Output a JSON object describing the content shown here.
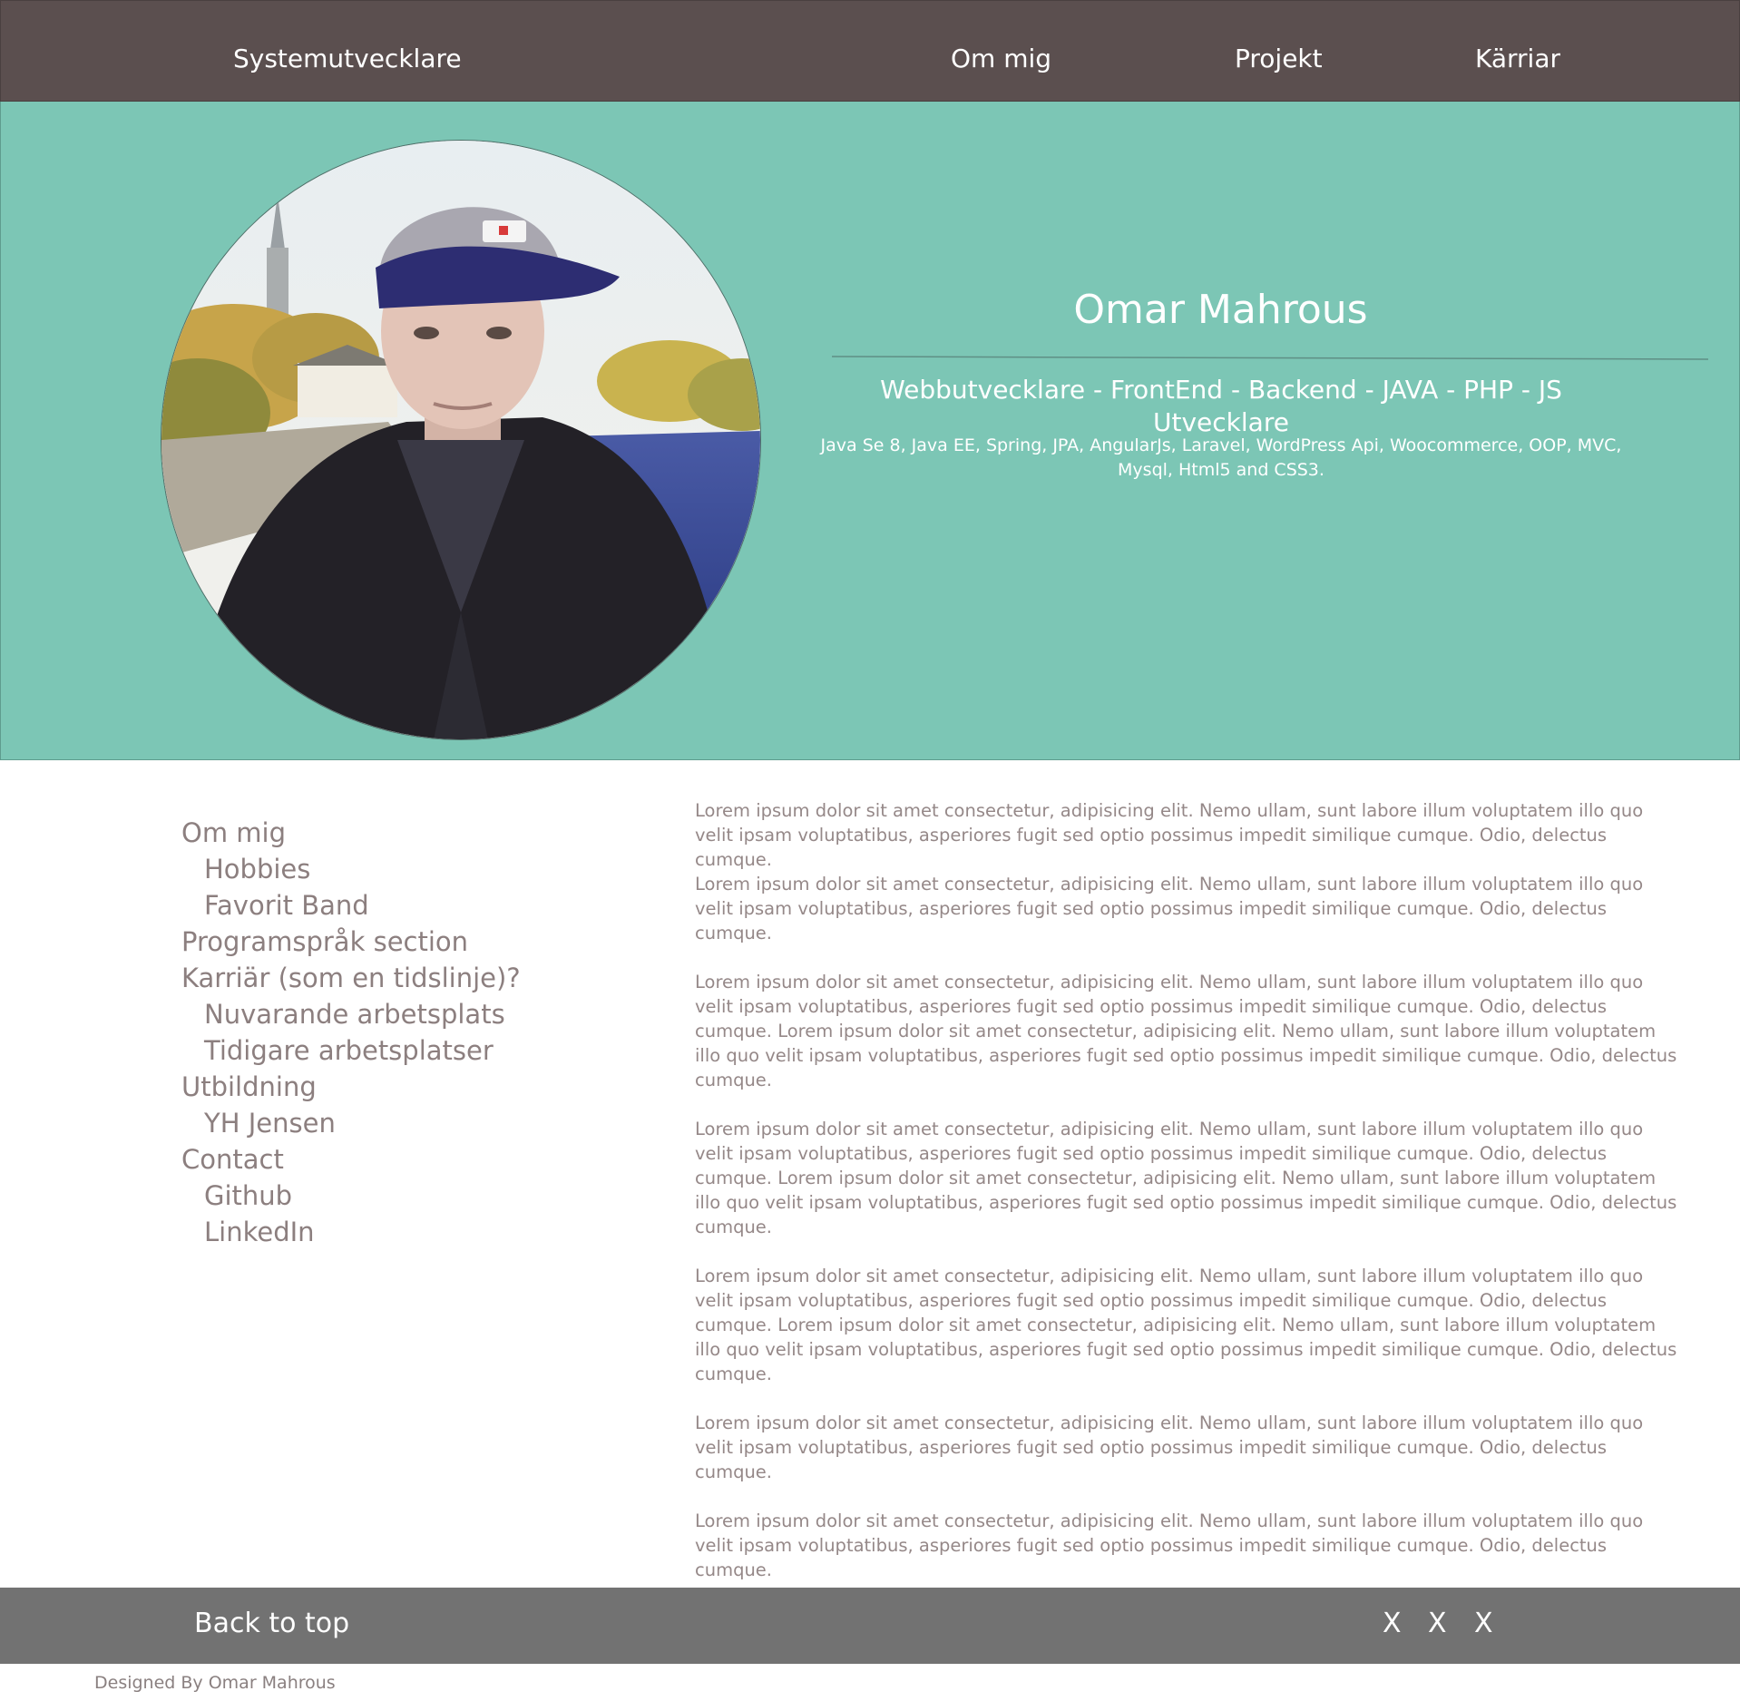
{
  "nav": {
    "brand": "Systemutvecklare",
    "links": [
      "Om mig",
      "Projekt",
      "Kärriar"
    ]
  },
  "hero": {
    "name": "Omar Mahrous",
    "roles": "Webbutvecklare - FrontEnd - Backend - JAVA - PHP - JS Utvecklare",
    "skills": "Java Se 8, Java EE, Spring, JPA, AngularJs, Laravel, WordPress Api, Woocommerce, OOP, MVC, Mysql, Html5 and CSS3."
  },
  "sidebar": {
    "items": [
      {
        "label": "Om mig",
        "level": 1
      },
      {
        "label": "Hobbies",
        "level": 2
      },
      {
        "label": "Favorit Band",
        "level": 2
      },
      {
        "label": "Programspråk section",
        "level": 1
      },
      {
        "label": "Karriär (som en tidslinje)?",
        "level": 1
      },
      {
        "label": "Nuvarande arbetsplats",
        "level": 2
      },
      {
        "label": "Tidigare arbetsplatser",
        "level": 2
      },
      {
        "label": "Utbildning",
        "level": 1
      },
      {
        "label": "YH Jensen",
        "level": 2
      },
      {
        "label": "Contact",
        "level": 1
      },
      {
        "label": "Github",
        "level": 2
      },
      {
        "label": "LinkedIn",
        "level": 2
      }
    ]
  },
  "content": {
    "paragraphs": [
      "Lorem ipsum dolor sit amet consectetur, adipisicing elit. Nemo ullam, sunt labore illum voluptatem illo quo velit ipsam voluptatibus, asperiores fugit sed optio possimus impedit similique cumque. Odio, delectus cumque.",
      "Lorem ipsum dolor sit amet consectetur, adipisicing elit. Nemo ullam, sunt labore illum voluptatem illo quo velit ipsam voluptatibus, asperiores fugit sed optio possimus impedit similique cumque. Odio, delectus cumque.",
      "Lorem ipsum dolor sit amet consectetur, adipisicing elit. Nemo ullam, sunt labore illum voluptatem illo quo velit ipsam voluptatibus, asperiores fugit sed optio possimus impedit similique cumque. Odio, delectus cumque. Lorem ipsum dolor sit amet consectetur, adipisicing elit. Nemo ullam, sunt labore illum voluptatem illo quo velit ipsam voluptatibus, asperiores fugit sed optio possimus impedit similique cumque. Odio, delectus cumque.",
      "Lorem ipsum dolor sit amet consectetur, adipisicing elit. Nemo ullam, sunt labore illum voluptatem illo quo velit ipsam voluptatibus, asperiores fugit sed optio possimus impedit similique cumque. Odio, delectus cumque. Lorem ipsum dolor sit amet consectetur, adipisicing elit. Nemo ullam, sunt labore illum voluptatem illo quo velit ipsam voluptatibus, asperiores fugit sed optio possimus impedit similique cumque. Odio, delectus cumque.",
      "Lorem ipsum dolor sit amet consectetur, adipisicing elit. Nemo ullam, sunt labore illum voluptatem illo quo velit ipsam voluptatibus, asperiores fugit sed optio possimus impedit similique cumque. Odio, delectus cumque. Lorem ipsum dolor sit amet consectetur, adipisicing elit. Nemo ullam, sunt labore illum voluptatem illo quo velit ipsam voluptatibus, asperiores fugit sed optio possimus impedit similique cumque. Odio, delectus cumque.",
      "Lorem ipsum dolor sit amet consectetur, adipisicing elit. Nemo ullam, sunt labore illum voluptatem illo quo velit ipsam voluptatibus, asperiores fugit sed optio possimus impedit similique cumque. Odio, delectus cumque.",
      "Lorem ipsum dolor sit amet consectetur, adipisicing elit. Nemo ullam, sunt labore illum voluptatem illo quo velit ipsam voluptatibus, asperiores fugit sed optio possimus impedit similique cumque. Odio, delectus cumque."
    ]
  },
  "footer": {
    "back_to_top": "Back to top",
    "social": [
      "X",
      "X",
      "X"
    ],
    "credit": "Designed By Omar Mahrous"
  },
  "colors": {
    "nav_bg": "#5b4f4f",
    "hero_bg": "#7cc6b5",
    "footer_bg": "#727272",
    "muted_text": "#8c7f7f"
  },
  "icons": {
    "avatar": "profile-photo"
  }
}
